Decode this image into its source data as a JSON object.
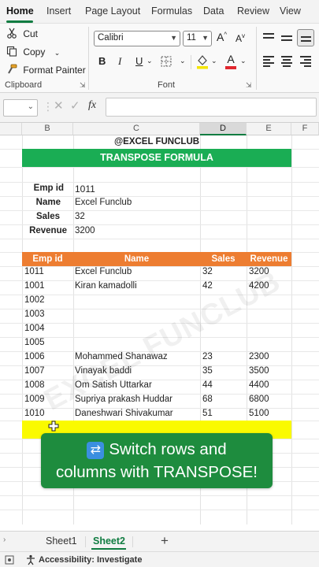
{
  "ribbon": {
    "tabs": [
      "Home",
      "Insert",
      "Page Layout",
      "Formulas",
      "Data",
      "Review",
      "View"
    ],
    "clipboard": {
      "cut": "Cut",
      "copy": "Copy",
      "format_painter": "Format Painter",
      "group_label": "Clipboard"
    },
    "font": {
      "family": "Calibri",
      "size": "11",
      "group_label": "Font",
      "bold": "B",
      "italic": "I",
      "underline": "U"
    }
  },
  "formula_bar": {
    "fx": "fx",
    "value": ""
  },
  "columns": [
    "B",
    "C",
    "D",
    "E",
    "F"
  ],
  "sheet": {
    "title": "@EXCEL FUNCLUB",
    "banner": "TRANSPOSE FORMULA",
    "record": [
      {
        "label": "Emp id",
        "value": "1011"
      },
      {
        "label": "Name",
        "value": "Excel Funclub"
      },
      {
        "label": "Sales",
        "value": "32"
      },
      {
        "label": "Revenue",
        "value": "3200"
      }
    ],
    "table_headers": [
      "Emp id",
      "Name",
      "Sales",
      "Revenue"
    ],
    "rows": [
      [
        "1011",
        "Excel Funclub",
        "32",
        "3200"
      ],
      [
        "1001",
        "Kiran kamadolli",
        "42",
        "4200"
      ],
      [
        "1002",
        "",
        "",
        ""
      ],
      [
        "1003",
        "",
        "",
        ""
      ],
      [
        "1004",
        "",
        "",
        ""
      ],
      [
        "1005",
        "",
        "",
        ""
      ],
      [
        "1006",
        "Mohammed Shanawaz",
        "23",
        "2300"
      ],
      [
        "1007",
        "Vinayak baddi",
        "35",
        "3500"
      ],
      [
        "1008",
        "Om Satish Uttarkar",
        "44",
        "4400"
      ],
      [
        "1009",
        "Supriya prakash Huddar",
        "68",
        "6800"
      ],
      [
        "1010",
        "Daneshwari Shivakumar",
        "51",
        "5100"
      ]
    ],
    "watermark": "EXCEL FUNCLUB"
  },
  "overlay": {
    "icon": "🔄",
    "line1": "Switch rows and",
    "line2": "columns with TRANSPOSE!"
  },
  "sheet_tabs": [
    "Sheet1",
    "Sheet2"
  ],
  "add_sheet": "+",
  "status": {
    "accessibility": "Accessibility: Investigate"
  },
  "colors": {
    "accent": "#107c41",
    "banner": "#1aad54",
    "table_header": "#ed7d31",
    "highlight": "#fafa00",
    "overlay": "#1e8c3e"
  }
}
